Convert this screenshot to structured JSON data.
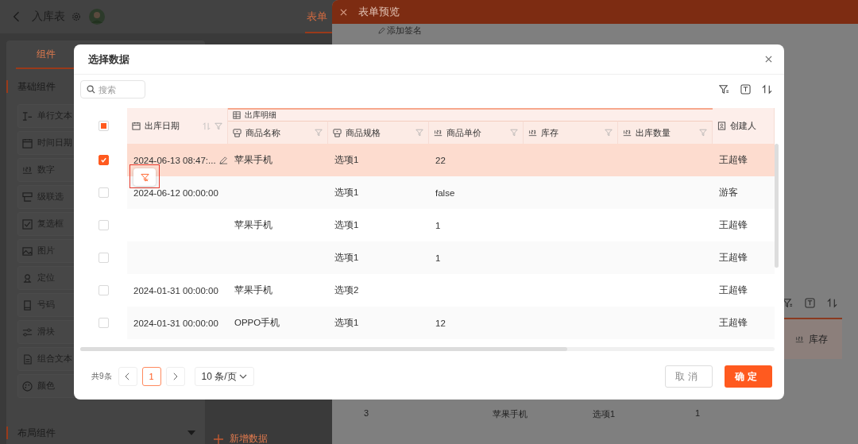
{
  "app": {
    "title": "入库表",
    "tab": {
      "label": "表单",
      "selected": true
    },
    "sidebar": {
      "tabs": [
        {
          "label": "组件",
          "selected": true
        }
      ],
      "section": "基础组件",
      "items": [
        {
          "label": "单行文本"
        },
        {
          "label": "时间日期"
        },
        {
          "label": "数字"
        },
        {
          "label": "级联选"
        },
        {
          "label": "复选框"
        },
        {
          "label": "图片"
        },
        {
          "label": "定位"
        },
        {
          "label": "号码"
        },
        {
          "label": "滑块"
        },
        {
          "label": "组合文本"
        },
        {
          "label": "颜色"
        }
      ],
      "footer_section": "布局组件"
    },
    "add_button": "新增数据"
  },
  "drawer": {
    "title": "表单预览",
    "signature": "添加签名",
    "column": "库存",
    "row": [
      "3",
      "苹果手机",
      "选项1",
      "1"
    ]
  },
  "dialog": {
    "title": "选择数据",
    "search": {
      "placeholder": "搜索"
    },
    "select_all": {
      "partial": true
    },
    "group_header": "出库明细",
    "columns": [
      {
        "label": "出库日期",
        "kind": "date",
        "grouped": false,
        "sortable": true,
        "filterable": true
      },
      {
        "label": "商品名称",
        "kind": "select",
        "grouped": true,
        "sortable": false,
        "filterable": true
      },
      {
        "label": "商品规格",
        "kind": "select",
        "grouped": true,
        "sortable": false,
        "filterable": true
      },
      {
        "label": "商品单价",
        "kind": "number",
        "grouped": true,
        "sortable": false,
        "filterable": true
      },
      {
        "label": "库存",
        "kind": "number",
        "grouped": true,
        "sortable": false,
        "filterable": true
      },
      {
        "label": "出库数量",
        "kind": "number",
        "grouped": true,
        "sortable": false,
        "filterable": true
      },
      {
        "label": "创建人",
        "kind": "person",
        "grouped": false,
        "sortable": false,
        "filterable": false
      }
    ],
    "rows": [
      {
        "selected": true,
        "editing": true,
        "filter_popup": true,
        "cells": [
          "2024-06-13 08:47:...",
          "苹果手机",
          "选项1",
          "22",
          "",
          "",
          "王超锋"
        ]
      },
      {
        "selected": false,
        "editing": false,
        "filter_popup": false,
        "cells": [
          "2024-06-12 00:00:00",
          "",
          "选项1",
          "false",
          "",
          "",
          "游客"
        ]
      },
      {
        "selected": false,
        "editing": false,
        "filter_popup": false,
        "cells": [
          "",
          "苹果手机",
          "选项1",
          "1",
          "",
          "",
          "王超锋"
        ]
      },
      {
        "selected": false,
        "editing": false,
        "filter_popup": false,
        "cells": [
          "",
          "",
          "选项1",
          "1",
          "",
          "",
          "王超锋"
        ]
      },
      {
        "selected": false,
        "editing": false,
        "filter_popup": false,
        "cells": [
          "2024-01-31 00:00:00",
          "苹果手机",
          "选项2",
          "",
          "",
          "",
          "王超锋"
        ]
      },
      {
        "selected": false,
        "editing": false,
        "filter_popup": false,
        "cells": [
          "2024-01-31 00:00:00",
          "OPPO手机",
          "选项1",
          "12",
          "",
          "",
          "王超锋"
        ]
      }
    ],
    "total": "共9条",
    "pages": [
      {
        "label": "1",
        "selected": true
      }
    ],
    "page_size": "10 条/页",
    "cancel": "取消",
    "confirm": "确定"
  }
}
